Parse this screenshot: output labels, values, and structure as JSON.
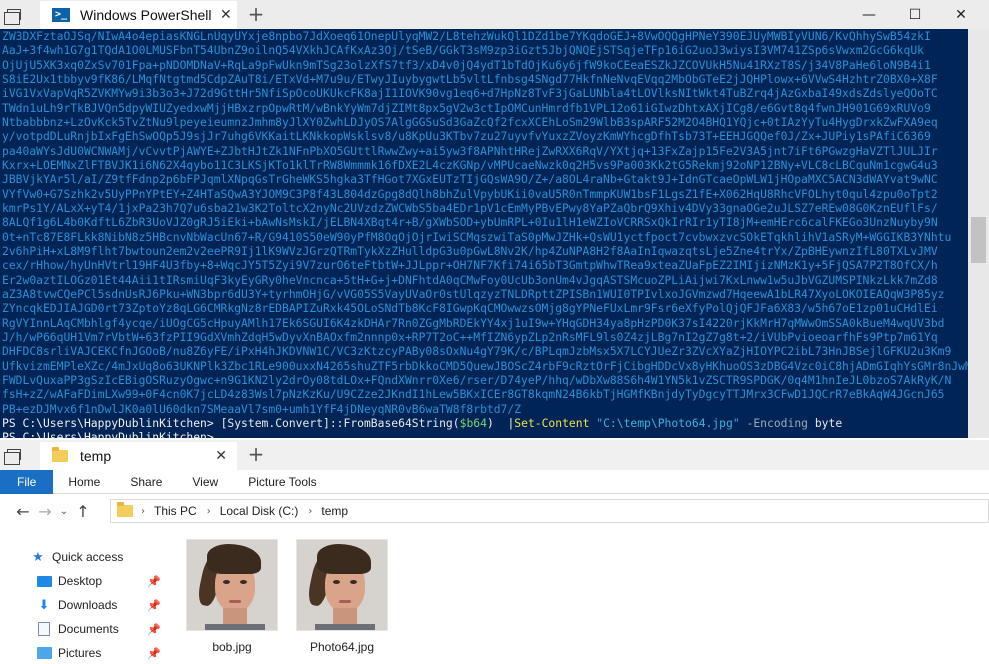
{
  "powershell": {
    "tab_title": "Windows PowerShell (x",
    "close_tab_glyph": "✕",
    "new_tab_glyph": "+",
    "window_controls": {
      "minimize": "—",
      "maximize": "☐",
      "close": "✕"
    },
    "base64_lines": [
      "ZW3DXFztaOJSq/NIwA4o4epiasKNGLnUqyUYxje8npbo7JdXoeq61OnepUlyqMW2/L8tehzWukQl1DZd1be7YKqdoGEJ+8VwOQQgHPNeY390EJUyMWBIyVUN6/KvQhhySwB54zkI",
      "AaJ+3f4wh1G7g1TQdA1O0LMUSFbnT54UbnZ9oilnQ54VXkhJCAfKxAz3Oj/tSeB/GGkT3sM9zp3iGzt5JbjQNQEjSTSqjeTFp16iG2uoJ3wiysI3VM741ZSp6sVwxm2GcG6kqUk",
      "OjUjU5XK3xq0ZxSv701Fpa+pNDOMDNaV+RqLa9pFwUkn9mTSg23olzXfS7tf3/xD4v0jQ4ydT1bTdOjKu6y6jfW9koCEeaESZkJZCOVUkH5Nu41RXzT8S/j34V8PaHe6loN9B4i1",
      "S8iE2Ux1tbbyv9fK86/LMqfNtgtmd5CdpZAuT8i/ETxVd+M7u9u/ETwyJIuybygwtLb5vltLfnbsg4SNgd77HkfnNeNvqEVqq2MbObGTeE2jJQHPlowx+6VVwS4HzhtrZ0BX0+X8F",
      "iVG1VxVapVqR5ZVKMYw9i3b3o3+J72d9GttHr5NfiSpOcoUKUkcFK8ajI1IOVK90vg1eq6+d7HpNz8TvF3jGaLUNbla4tLOVlksNItWkt4TuBZrq4jAzGxbaI49xdsZdslyeQOoTC",
      "TWdn1uLh9rTkBJVQn5dpyWIUZyedxwMjjHBxzrpOpwRtM/wBnkYyWm7djZIMt8px5gV2w3ctIpOMCunHmrdfb1VPL12o61iGIwzDhtxAXjICg8/e6Gvt8q4fwnJH901G69xRUVo9",
      "Ntbabbbnz+LzOvKck5TvZtNu9lpeyeieumnzJmhm8yJlXY0ZwhLDJyOS7AlgGGSuSd3GaZcQf2fcxXCEhLoSm29WlbB3spARF52M2O4BHQ1YQjc+0tIAzYyTu4HygDrxkZwFXA9eq",
      "y/votpdDLuRnjbIxFgEhSwOQp5J9sjJr7uhg6VKKaitLKNkkopWsklsv8/u8KpUu3KTbv7zu27uyvfvYuxzZVoyzKmWYhcgDfhTsb73T+EEHJGQQef0J/Zx+JUPiy1sPAfiC6369",
      "pa40aWYsJdU0WCNWAMj/vCvvtPjAWYE+ZJbtHJtZk1NFnPbXO5GUttlRwwZwy+ai5yw3f8APNhtHRejZwRXX6RqV/YXtjq+13FxZajp15Fe2V3A5jnt7iFt6PGwzgHaVZTlJULJIr",
      "Kxrx+LOEMNxZlFTBVJK1i6N62X4qybo11C3LKSjKTo1klTrRW8Wmmmk16fDXE2L4czKGNp/vMPUcaeNwzk0q2H5vs9Pa003Kk2tG5Rekmj92oNP12BNy+VLC8cLBCquNm1cgwG4u3",
      "JBBVjkYAr5l/aI/Z9tfFdnp2p6bFPJqmlXNpqGsTrGheWKS5hgka3TfHGot7XGxEUTzTIjGQsWA9O/Z+/a8OL4raNb+Gtakt9J+IdnGTcaeOpWLW1jHOpaMXC5ACN3dWAYvat9wNC",
      "VYfVw0+G7Szhk2v5UyPPnYPtEY+Z4HTaSQwA3YJOM9C3P8f43L804dzGpg8dQlh8bhZulVpybUKii0vaU5R0nTmmpKUW1bsF1LgsZ1fE+X062HqU8RhcVFOLhyt0qul4zpu0oTpt2",
      "kmrPs1Y/ALxX+yT4/1jxPa23h7Q7u6sba21w3K2ToltcX2nyNc2UVzdzZWCWbS5ba4EDr1pV1cEmMyPBvEPwy8YaPZaQbrQ9Xhiv4DVy33gnaOGe2uJLSZ7eREw08G0KznEUflFs/",
      "8ALQf1g6L4b0KdftL6ZbR3UoVJZ0gRJ5iEki+bAwNsMskI/jELBN4XBqt4r+B/gXWbSOD+ybUmRPL+0Iu1lH1eWZIoVCRRSxQkIrRIr1yTI8jM+emHErc6calFKEGo3UnzNuyby9N",
      "0t+nTc87E8FLkk8NibN8z5HBcnvNbWacUn67+R/G9410S50eW90yPfM8OqOjOjrIwiSCMqszwiTaS0pMwJZHk+QsWU1yctfpoct7cvbwxzvcSOkETqkhlihV1aSRyM+WGGIKB3YNhtu",
      "2v6hPiH+xL8M9flht7bwtoun2em2v2eePR9Ij1lK9WVzJGrzQTRmTykXzZHulldpG3u0pGwL8Nv2K/hp4ZuNPA8H2f8AaInIqwazqtsLje5Zne4trYx/ZpBHEywnzIfL80TXLvJMV",
      "cex/rHhow/hyUnHVtrl19HF4U3fby+8+WqcJY5T5Zyi9V7zurO6teFtbtW+JJLppr+OH7NF7Kfi74i65bT3GmtpWhwTRea9xteaZUaFpEZ2IMIjizNMzK1y+5FjQSA7P2T8OfCX/h",
      "Er2w0aztILOGz01Et44Aii1tIRsmiUqF3kyEyGRy0heVncnca+5tH+G+j+DNFhtdA0qCMwFoy0UcUb3onUm4vJgqASTSMcuoZPLiAijwi7KxLnww1w5uJbVGZUMSPINkzLkk7mZd8",
      "aZ3A8tvwCQePCl5sdnUsRJ6Pku+WN3bpr6dU3Y+tyrhmOHjG/vVG05S5VayUVaOr0stUlqzyzTNLDRpttZPISBn1WUI0TPIvlxoJGVmzwd7HqeewA1bLR47XyoLOKOIEAQqW3P85yz",
      "ZYncqkEDJIAJGD0rt73ZptoYz8qLG6CMRkgNz8rEDBAPIZuRxk45OLoSNdTb8KcF8IGwpKqCMOwwzsOMjg8gYPNeFUxLmr9Fsr6eXfyPolQjQFJFa6X83/w5h67oE1zp01uCHdlEi",
      "RgVYInnLAqCMbhlgf4ycqe/iUOgCG5cHpuyAMlh17Ek6SGUI6K4zkDHAr7Rn0ZGgMbRDEkYY4xj1uI9w+YHqGDH34ya8pHzPD0K37sI4220rjKkMrH7qMWwOmSSA0kBueM4wqUV3bd",
      "J/h/wP66qUH1Vm7rVbtW+63fzPII9GdXVmhZdqH5wDyvXnBAOxfm2nnnp0x+RP7T2oC++MfIZN6ypZLp2nRsMFL9ls0Z4zjLBg7nI2gZ7g8t+2/iVUbPvioeoarfhFs9Ptp7m61Yq",
      "DHFDC8srliVAJCEKCfnJGOoB/nu8Z6yFE/iPxH4hJKDVNW1C/VC3zKtzcyPABy08sOxNu4gY79K/c/BPLqmJzbMsx5X7LCYJUeZr3ZVcXYaZjHIOYPC2ibL73HnJBSejlGFKU2u3Km9",
      "UfkvizmEMPleXZc/4mJxUq8o63UKNPlk3Zbc1RLe900uxxN4265shuZTF5rbDkkoCMD5QuewJBOScZ4rbF9cRztOrFjCibgHDDcVx8yHKhuoOS3zDBG4Vzc0iC8hjADmGIqhYsGMr8nJwMnCrgkjqT2",
      "FWDLvQuxaPP3gSzIcEBigOSRuzyOgwc+n9G1KN2ly2drOy08tdLOx+FQndXWnrr0Xe6/rser/D74yeP/hhq/wDbXw88S6h4W1YN5k1vZSCTR9SPDGK/0q4M1hnIeJL0bzoS7AkRyK/N",
      "fsH+zZ/wAFaFDimLXw99+0F4cn0K7jcLD4z83Wsl7pNzKzKu/U9CZze2JKndI1hLew5BKxICEr8GT8kqmN24B6kbTjHGMfKBnjdyTyDgcyTTJMrx3CFwD1JQCrR7eBkAqW4JGcnJ65",
      "PB+ezDJMvx6f1nDwlJK0a0lU60dkn7SMeaaVl7sm0+umh1YfF4jDNeyqNR0vB6waTW8f8rbtd7/Z"
    ],
    "prompt_path": "PS C:\\Users\\HappyDublinKitchen>",
    "command": {
      "type": "[System.Convert]::FromBase64String(",
      "var": "$b64",
      "close": ")  ",
      "pipe": "|",
      "cmdlet": "Set-Content",
      "path": "\"C:\\temp\\Photo64.jpg\"",
      "param": "-Encoding",
      "value": "byte"
    }
  },
  "explorer": {
    "tab_title": "temp",
    "close_tab_glyph": "✕",
    "new_tab_glyph": "+",
    "ribbon": {
      "file": "File",
      "home": "Home",
      "share": "Share",
      "view": "View",
      "picture_tools": "Picture Tools"
    },
    "nav_glyphs": {
      "back": "←",
      "forward": "→",
      "recent": "⌄",
      "up": "↑"
    },
    "breadcrumb": [
      "This PC",
      "Local Disk (C:)",
      "temp"
    ],
    "breadcrumb_sep": "›",
    "sidebar": [
      {
        "label": "Quick access",
        "icon": "star-icon"
      },
      {
        "label": "Desktop",
        "icon": "desktop-icon"
      },
      {
        "label": "Downloads",
        "icon": "downloads-icon"
      },
      {
        "label": "Documents",
        "icon": "documents-icon"
      },
      {
        "label": "Pictures",
        "icon": "pictures-icon"
      }
    ],
    "pin_glyph": "📌",
    "files": [
      {
        "name": "bob.jpg"
      },
      {
        "name": "Photo64.jpg"
      }
    ]
  }
}
